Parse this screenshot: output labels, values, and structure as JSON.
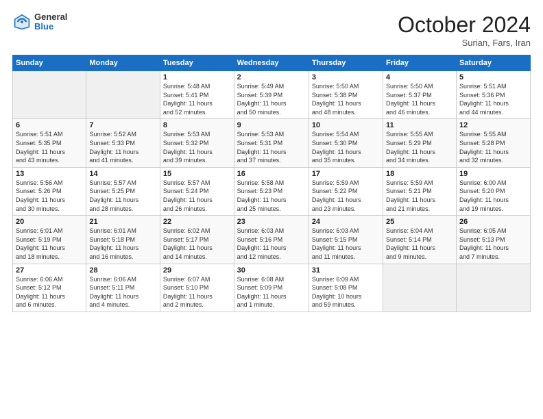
{
  "logo": {
    "general": "General",
    "blue": "Blue"
  },
  "header": {
    "month": "October 2024",
    "location": "Surian, Fars, Iran"
  },
  "weekdays": [
    "Sunday",
    "Monday",
    "Tuesday",
    "Wednesday",
    "Thursday",
    "Friday",
    "Saturday"
  ],
  "rows": [
    [
      {
        "day": "",
        "info": ""
      },
      {
        "day": "",
        "info": ""
      },
      {
        "day": "1",
        "info": "Sunrise: 5:48 AM\nSunset: 5:41 PM\nDaylight: 11 hours\nand 52 minutes."
      },
      {
        "day": "2",
        "info": "Sunrise: 5:49 AM\nSunset: 5:39 PM\nDaylight: 11 hours\nand 50 minutes."
      },
      {
        "day": "3",
        "info": "Sunrise: 5:50 AM\nSunset: 5:38 PM\nDaylight: 11 hours\nand 48 minutes."
      },
      {
        "day": "4",
        "info": "Sunrise: 5:50 AM\nSunset: 5:37 PM\nDaylight: 11 hours\nand 46 minutes."
      },
      {
        "day": "5",
        "info": "Sunrise: 5:51 AM\nSunset: 5:36 PM\nDaylight: 11 hours\nand 44 minutes."
      }
    ],
    [
      {
        "day": "6",
        "info": "Sunrise: 5:51 AM\nSunset: 5:35 PM\nDaylight: 11 hours\nand 43 minutes."
      },
      {
        "day": "7",
        "info": "Sunrise: 5:52 AM\nSunset: 5:33 PM\nDaylight: 11 hours\nand 41 minutes."
      },
      {
        "day": "8",
        "info": "Sunrise: 5:53 AM\nSunset: 5:32 PM\nDaylight: 11 hours\nand 39 minutes."
      },
      {
        "day": "9",
        "info": "Sunrise: 5:53 AM\nSunset: 5:31 PM\nDaylight: 11 hours\nand 37 minutes."
      },
      {
        "day": "10",
        "info": "Sunrise: 5:54 AM\nSunset: 5:30 PM\nDaylight: 11 hours\nand 35 minutes."
      },
      {
        "day": "11",
        "info": "Sunrise: 5:55 AM\nSunset: 5:29 PM\nDaylight: 11 hours\nand 34 minutes."
      },
      {
        "day": "12",
        "info": "Sunrise: 5:55 AM\nSunset: 5:28 PM\nDaylight: 11 hours\nand 32 minutes."
      }
    ],
    [
      {
        "day": "13",
        "info": "Sunrise: 5:56 AM\nSunset: 5:26 PM\nDaylight: 11 hours\nand 30 minutes."
      },
      {
        "day": "14",
        "info": "Sunrise: 5:57 AM\nSunset: 5:25 PM\nDaylight: 11 hours\nand 28 minutes."
      },
      {
        "day": "15",
        "info": "Sunrise: 5:57 AM\nSunset: 5:24 PM\nDaylight: 11 hours\nand 26 minutes."
      },
      {
        "day": "16",
        "info": "Sunrise: 5:58 AM\nSunset: 5:23 PM\nDaylight: 11 hours\nand 25 minutes."
      },
      {
        "day": "17",
        "info": "Sunrise: 5:59 AM\nSunset: 5:22 PM\nDaylight: 11 hours\nand 23 minutes."
      },
      {
        "day": "18",
        "info": "Sunrise: 5:59 AM\nSunset: 5:21 PM\nDaylight: 11 hours\nand 21 minutes."
      },
      {
        "day": "19",
        "info": "Sunrise: 6:00 AM\nSunset: 5:20 PM\nDaylight: 11 hours\nand 19 minutes."
      }
    ],
    [
      {
        "day": "20",
        "info": "Sunrise: 6:01 AM\nSunset: 5:19 PM\nDaylight: 11 hours\nand 18 minutes."
      },
      {
        "day": "21",
        "info": "Sunrise: 6:01 AM\nSunset: 5:18 PM\nDaylight: 11 hours\nand 16 minutes."
      },
      {
        "day": "22",
        "info": "Sunrise: 6:02 AM\nSunset: 5:17 PM\nDaylight: 11 hours\nand 14 minutes."
      },
      {
        "day": "23",
        "info": "Sunrise: 6:03 AM\nSunset: 5:16 PM\nDaylight: 11 hours\nand 12 minutes."
      },
      {
        "day": "24",
        "info": "Sunrise: 6:03 AM\nSunset: 5:15 PM\nDaylight: 11 hours\nand 11 minutes."
      },
      {
        "day": "25",
        "info": "Sunrise: 6:04 AM\nSunset: 5:14 PM\nDaylight: 11 hours\nand 9 minutes."
      },
      {
        "day": "26",
        "info": "Sunrise: 6:05 AM\nSunset: 5:13 PM\nDaylight: 11 hours\nand 7 minutes."
      }
    ],
    [
      {
        "day": "27",
        "info": "Sunrise: 6:06 AM\nSunset: 5:12 PM\nDaylight: 11 hours\nand 6 minutes."
      },
      {
        "day": "28",
        "info": "Sunrise: 6:06 AM\nSunset: 5:11 PM\nDaylight: 11 hours\nand 4 minutes."
      },
      {
        "day": "29",
        "info": "Sunrise: 6:07 AM\nSunset: 5:10 PM\nDaylight: 11 hours\nand 2 minutes."
      },
      {
        "day": "30",
        "info": "Sunrise: 6:08 AM\nSunset: 5:09 PM\nDaylight: 11 hours\nand 1 minute."
      },
      {
        "day": "31",
        "info": "Sunrise: 6:09 AM\nSunset: 5:08 PM\nDaylight: 10 hours\nand 59 minutes."
      },
      {
        "day": "",
        "info": ""
      },
      {
        "day": "",
        "info": ""
      }
    ]
  ]
}
